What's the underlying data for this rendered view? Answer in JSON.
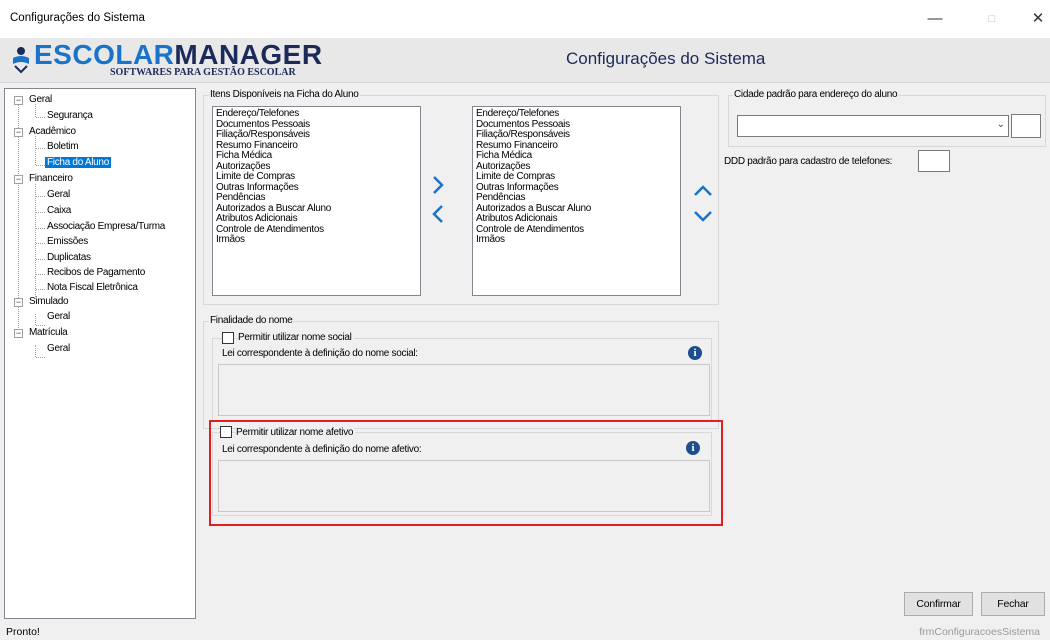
{
  "window": {
    "title": "Configurações do Sistema",
    "controls": [
      "minimize-icon",
      "maximize-icon",
      "close-icon"
    ]
  },
  "header": {
    "logo_part1": "ESCOLAR",
    "logo_part2": "MANAGER",
    "logo_tagline": "SOFTWARES PARA GESTÃO ESCOLAR",
    "title": "Configurações do Sistema"
  },
  "tree": {
    "items": [
      {
        "label": "Geral"
      },
      {
        "label": "Segurança"
      },
      {
        "label": "Acadêmico"
      },
      {
        "label": "Boletim"
      },
      {
        "label": "Ficha do Aluno",
        "selected": true
      },
      {
        "label": "Financeiro"
      },
      {
        "label": "Geral"
      },
      {
        "label": "Caixa"
      },
      {
        "label": "Associação Empresa/Turma"
      },
      {
        "label": "Emissões"
      },
      {
        "label": "Duplicatas"
      },
      {
        "label": "Recibos de Pagamento"
      },
      {
        "label": "Nota Fiscal Eletrônica"
      },
      {
        "label": "Simulado"
      },
      {
        "label": "Geral"
      },
      {
        "label": "Matrícula"
      },
      {
        "label": "Geral"
      }
    ]
  },
  "itens_ficha": {
    "group_label": "Itens Disponíveis na Ficha do Aluno",
    "available": [
      "Endereço/Telefones",
      "Documentos Pessoais",
      "Filiação/Responsáveis",
      "Resumo Financeiro",
      "Ficha Médica",
      "Autorizações",
      "Limite de Compras",
      "Outras Informações",
      "Pendências",
      "Autorizados a Buscar Aluno",
      "Atributos Adicionais",
      "Controle de Atendimentos",
      "Irmãos"
    ],
    "selected": [
      "Endereço/Telefones",
      "Documentos Pessoais",
      "Filiação/Responsáveis",
      "Resumo Financeiro",
      "Ficha Médica",
      "Autorizações",
      "Limite de Compras",
      "Outras Informações",
      "Pendências",
      "Autorizados a Buscar Aluno",
      "Atributos Adicionais",
      "Controle de Atendimentos",
      "Irmãos"
    ]
  },
  "finalidade": {
    "group_label": "Finalidade do nome",
    "social_checkbox": "Permitir utilizar nome social",
    "social_law": "Lei correspondente à definição do nome social:",
    "afetivo_checkbox": "Permitir utilizar nome afetivo",
    "afetivo_law": "Lei correspondente à definição do nome afetivo:",
    "highlight_color": "#e02020"
  },
  "right_panel": {
    "cidade_label": "Cidade padrão para endereço do aluno",
    "cidade_value": "",
    "ddd_label": "DDD padrão para cadastro de telefones:",
    "ddd_value": ""
  },
  "buttons": {
    "confirm": "Confirmar",
    "close": "Fechar"
  },
  "status": {
    "left": "Pronto!",
    "right": "frmConfiguracoesSistema"
  },
  "colors": {
    "selection": "#0078d7",
    "arrow": "#1a73c9",
    "logo_blue": "#1a73c9",
    "logo_navy": "#1c2a5a"
  }
}
